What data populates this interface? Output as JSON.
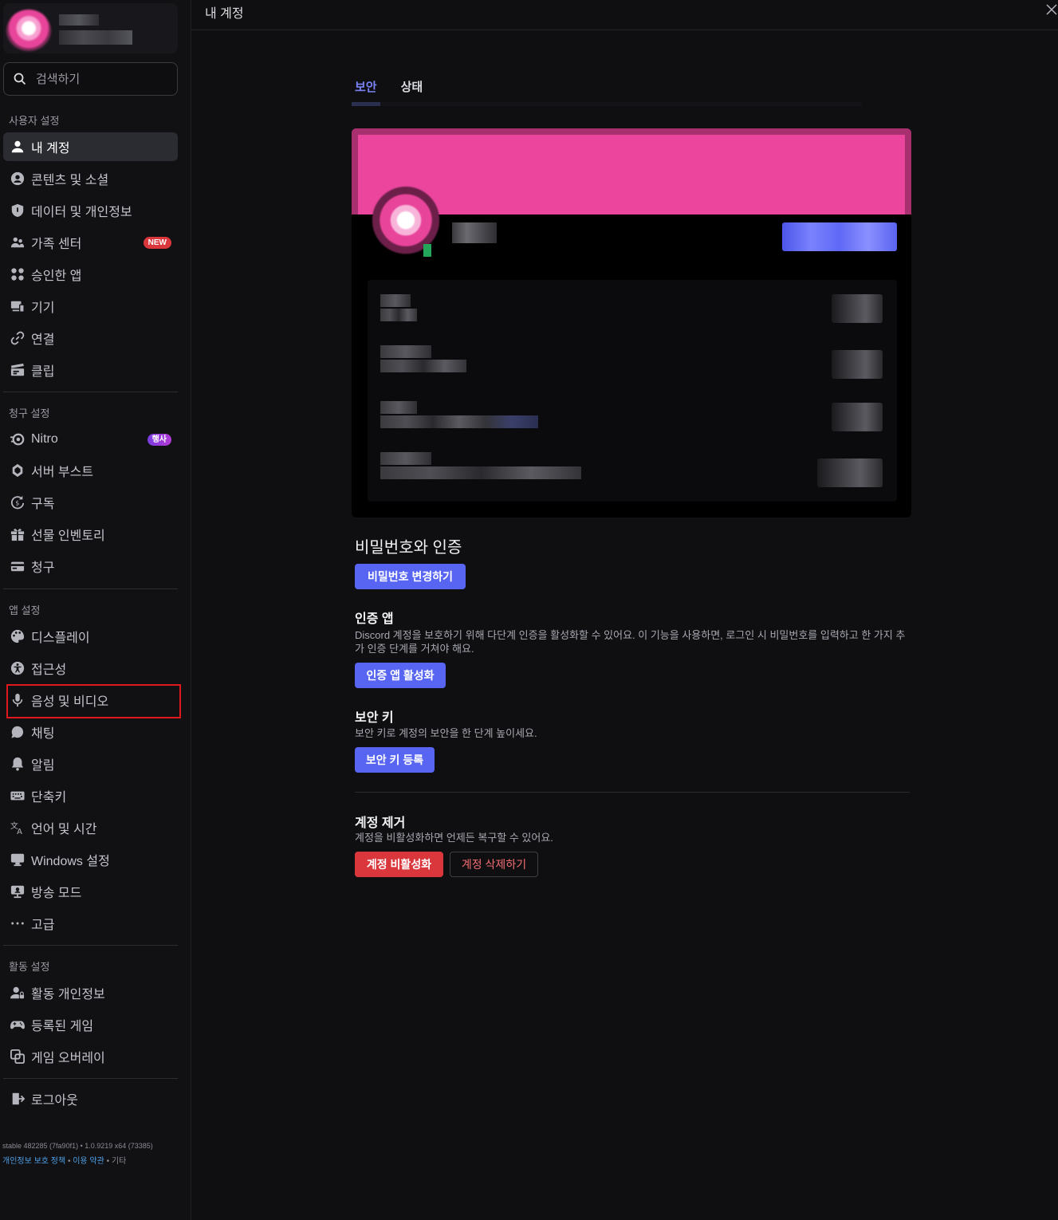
{
  "window": {
    "title": "내 계정"
  },
  "search": {
    "placeholder": "검색하기"
  },
  "sidebar": {
    "sections": {
      "user": "사용자 설정",
      "billing": "청구 설정",
      "app": "앱 설정",
      "activity": "활동 설정"
    },
    "items": {
      "my_account": "내 계정",
      "content_social": "콘텐츠 및 소셜",
      "data_privacy": "데이터 및 개인정보",
      "family_center": "가족 센터",
      "authorized_apps": "승인한 앱",
      "devices": "기기",
      "connections": "연결",
      "clips": "클립",
      "nitro": "Nitro",
      "server_boost": "서버 부스트",
      "subscriptions": "구독",
      "gift_inventory": "선물 인벤토리",
      "billing": "청구",
      "display": "디스플레이",
      "accessibility": "접근성",
      "voice_video": "음성 및 비디오",
      "chat": "채팅",
      "notifications": "알림",
      "keybinds": "단축키",
      "language_time": "언어 및 시간",
      "windows_settings": "Windows 설정",
      "streamer_mode": "방송 모드",
      "advanced": "고급",
      "activity_privacy": "활동 개인정보",
      "registered_games": "등록된 게임",
      "game_overlay": "게임 오버레이",
      "logout": "로그아웃"
    },
    "badges": {
      "new": "NEW",
      "event": "행사"
    }
  },
  "footer": {
    "version": "stable 482285 (7fa90f1) • 1.0.9219 x64 (73385)",
    "privacy": "개인정보 보호 정책",
    "sep1": " • ",
    "terms": "이용 약관",
    "sep2": " • 기타"
  },
  "tabs": {
    "security": "보안",
    "status": "상태"
  },
  "password_auth": {
    "title": "비밀번호와 인증",
    "change_password": "비밀번호 변경하기",
    "auth_app_title": "인증 앱",
    "auth_app_desc": "Discord 계정을 보호하기 위해 다단계 인증을 활성화할 수 있어요. 이 기능을 사용하면, 로그인 시 비밀번호를 입력하고 한 가지 추가 인증 단계를 거쳐야 해요.",
    "auth_app_button": "인증 앱 활성화",
    "security_key_title": "보안 키",
    "security_key_desc": "보안 키로 계정의 보안을 한 단계 높이세요.",
    "security_key_button": "보안 키 등록"
  },
  "account_removal": {
    "title": "계정 제거",
    "desc": "계정을 비활성화하면 언제든 복구할 수 있어요.",
    "disable": "계정 비활성화",
    "delete": "계정 삭제하기"
  },
  "colors": {
    "accent": "#5865f2",
    "banner": "#eb459e",
    "danger": "#da373c",
    "highlight": "#e0181c"
  }
}
